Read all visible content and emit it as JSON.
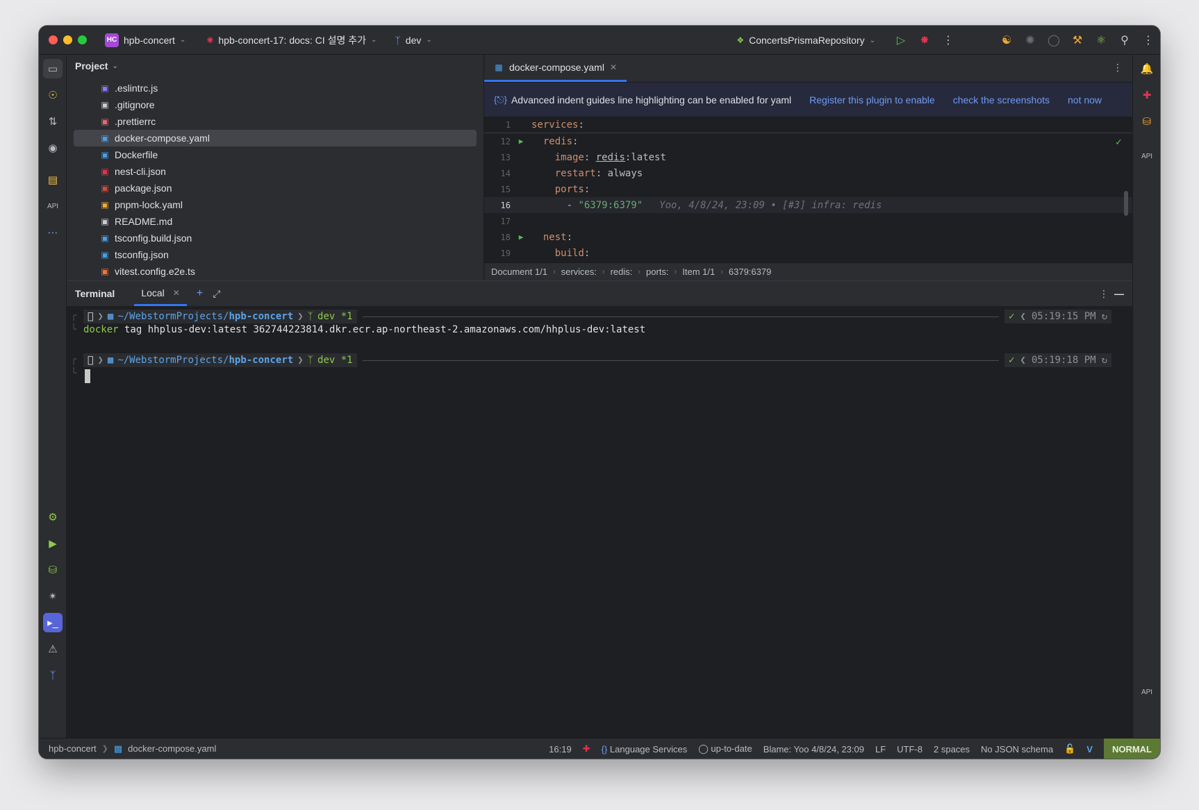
{
  "titlebar": {
    "project_badge": "HC",
    "project_name": "hpb-concert",
    "branch_task": "hpb-concert-17: docs: CI 설명 추가",
    "branch": "dev",
    "run_config": "ConcertsPrismaRepository"
  },
  "project_panel": {
    "title": "Project",
    "files": [
      {
        "name": ".eslintrc.js",
        "icon": "eslint-icon",
        "color": "#8a7cf0"
      },
      {
        "name": ".gitignore",
        "icon": "gitignore-icon",
        "color": "#c9ccd1"
      },
      {
        "name": ".prettierrc",
        "icon": "prettier-icon",
        "color": "#e06c75"
      },
      {
        "name": "docker-compose.yaml",
        "icon": "docker-icon",
        "color": "#4a9fe8"
      },
      {
        "name": "Dockerfile",
        "icon": "docker-icon",
        "color": "#4a9fe8"
      },
      {
        "name": "nest-cli.json",
        "icon": "nest-icon",
        "color": "#e0344f"
      },
      {
        "name": "package.json",
        "icon": "npm-icon",
        "color": "#d9473f"
      },
      {
        "name": "pnpm-lock.yaml",
        "icon": "pnpm-icon",
        "color": "#f2a83a"
      },
      {
        "name": "README.md",
        "icon": "markdown-icon",
        "color": "#c9ccd1"
      },
      {
        "name": "tsconfig.build.json",
        "icon": "tsconfig-icon",
        "color": "#4a9fe8"
      },
      {
        "name": "tsconfig.json",
        "icon": "tsconfig-icon",
        "color": "#4a9fe8"
      },
      {
        "name": "vitest.config.e2e.ts",
        "icon": "vitest-icon",
        "color": "#f2743a"
      }
    ],
    "selected": "docker-compose.yaml"
  },
  "editor": {
    "tab_label": "docker-compose.yaml",
    "banner": {
      "text": "Advanced indent guides line highlighting can be enabled for yaml",
      "link_register": "Register this plugin to enable",
      "link_screenshots": "check the screenshots",
      "link_dismiss": "not now"
    },
    "lines": [
      {
        "num": "1",
        "indent": "",
        "key": "services",
        "rest": ""
      },
      {
        "num": "12",
        "indent": "  ",
        "key": "redis",
        "rest": "",
        "run": true
      },
      {
        "num": "13",
        "indent": "    ",
        "key": "image",
        "rest_pre": "redis",
        "rest_post": ":latest"
      },
      {
        "num": "14",
        "indent": "    ",
        "key": "restart",
        "rest": " always"
      },
      {
        "num": "15",
        "indent": "    ",
        "key": "ports",
        "rest": ""
      },
      {
        "num": "16",
        "indent": "      ",
        "item": "\"6379:6379\"",
        "blame": "Yoo, 4/8/24, 23:09 • [#3] infra: redis"
      },
      {
        "num": "17",
        "indent": "",
        "key": "",
        "rest": ""
      },
      {
        "num": "18",
        "indent": "  ",
        "key": "nest",
        "rest": "",
        "run": true
      },
      {
        "num": "19",
        "indent": "    ",
        "key": "build",
        "rest": ""
      }
    ],
    "breadcrumbs": [
      "Document 1/1",
      "services:",
      "redis:",
      "ports:",
      "Item 1/1",
      "6379:6379"
    ]
  },
  "terminal": {
    "title": "Terminal",
    "tab_label": "Local",
    "prompts": [
      {
        "path_prefix": "~/WebstormProjects/",
        "path_dir": "hpb-concert",
        "branch": "dev *1",
        "time": "05:19:15 PM"
      },
      {
        "path_prefix": "~/WebstormProjects/",
        "path_dir": "hpb-concert",
        "branch": "dev *1",
        "time": "05:19:18 PM"
      }
    ],
    "command_bin": "docker",
    "command_args": " tag hhplus-dev:latest 362744223814.dkr.ecr.ap-northeast-2.amazonaws.com/hhplus-dev:latest"
  },
  "statusbar": {
    "project": "hpb-concert",
    "file": "docker-compose.yaml",
    "position": "16:19",
    "language_services": "Language Services",
    "vcs_status": "up-to-date",
    "blame": "Blame: Yoo 4/8/24, 23:09",
    "line_sep": "LF",
    "encoding": "UTF-8",
    "indent": "2 spaces",
    "schema": "No JSON schema",
    "mode": "NORMAL"
  }
}
